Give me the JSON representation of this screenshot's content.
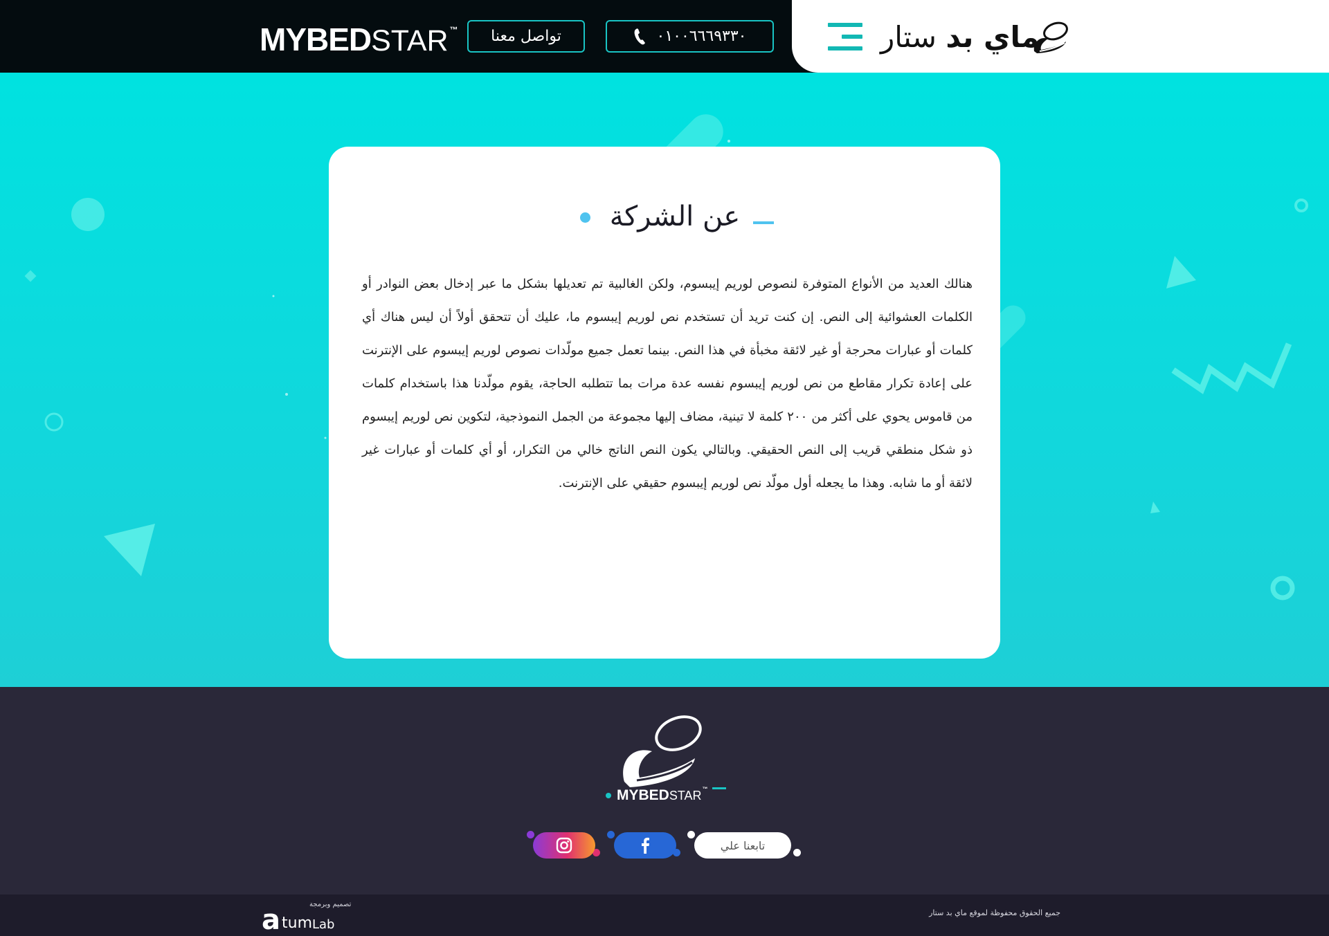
{
  "header": {
    "brand_ar_bold": "ماي بد",
    "brand_ar_light": "ستار",
    "phone": "٠١٠٠٦٦٦٩٣٣٠",
    "contact_label": "تواصل معنا",
    "brand_en_bold": "MYBED",
    "brand_en_thin": "STAR",
    "brand_en_tm": "™",
    "icons": [
      "menu-icon",
      "phone-icon",
      "brand-logo-icon"
    ]
  },
  "main": {
    "title": "عن الشركة",
    "body": "هنالك العديد من الأنواع المتوفرة لنصوص لوريم إيبسوم، ولكن الغالبية تم تعديلها بشكل ما عبر إدخال بعض النوادر أو الكلمات العشوائية إلى النص. إن كنت تريد أن تستخدم نص لوريم إيبسوم ما، عليك أن تتحقق أولاً أن ليس هناك أي كلمات أو عبارات محرجة أو غير لائقة مخبأة في هذا النص. بينما تعمل جميع مولّدات نصوص لوريم إيبسوم على الإنترنت على إعادة تكرار مقاطع من نص لوريم إيبسوم نفسه عدة مرات بما تتطلبه الحاجة، يقوم مولّدنا هذا باستخدام كلمات من قاموس يحوي على أكثر من ٢٠٠ كلمة لا تينية، مضاف إليها مجموعة من الجمل النموذجية، لتكوين نص لوريم إيبسوم ذو شكل منطقي قريب إلى النص الحقيقي. وبالتالي يكون النص الناتج خالي من التكرار، أو أي كلمات أو عبارات غير لائقة أو ما شابه. وهذا ما يجعله أول مولّد نص لوريم إيبسوم حقيقي على الإنترنت."
  },
  "footer": {
    "brand_bold": "MYBED",
    "brand_thin": "STAR",
    "brand_tm": "™",
    "follow_label": "تابعنا علي",
    "social": [
      "facebook-icon",
      "instagram-icon"
    ],
    "copyright": "جميع الحقوق محفوظة لموقع ماي بد ستار",
    "designer_label": "تصميم وبرمجة",
    "designer_a": "a",
    "designer_rest": "tum",
    "designer_lab": "Lab"
  },
  "colors": {
    "accent": "#19c4c4",
    "hero": "#00e2e0",
    "header_dark": "#040c0f",
    "footer": "#2a2839",
    "title_dot": "#4fc3ef",
    "facebook": "#2767d6"
  }
}
